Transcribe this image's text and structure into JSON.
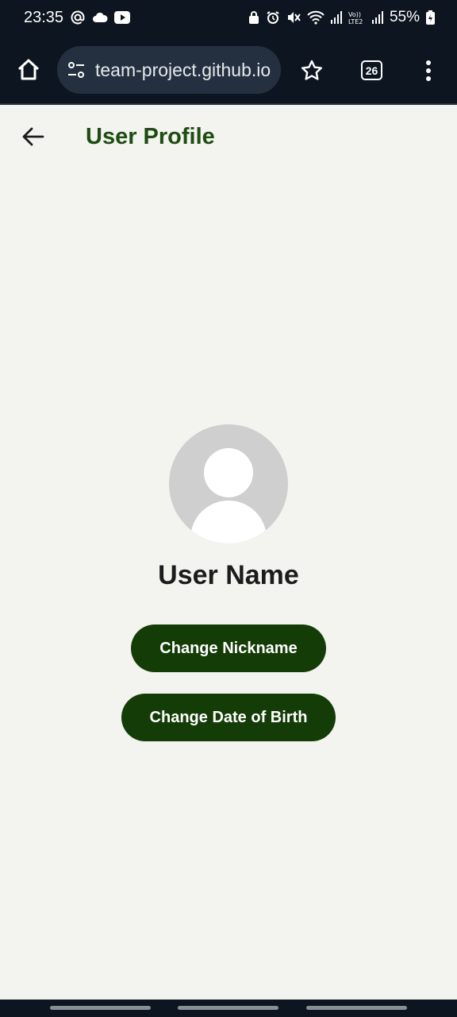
{
  "status_bar": {
    "time": "23:35",
    "battery_text": "55%",
    "icons_left": [
      "at-sign-icon",
      "cloud-icon",
      "youtube-icon"
    ],
    "icons_right": [
      "lock-icon",
      "alarm-icon",
      "mute-icon",
      "wifi-icon",
      "signal-icon",
      "volte-icon",
      "signal-icon",
      "battery-icon"
    ]
  },
  "browser": {
    "url": "team-project.github.io",
    "tab_count": "26"
  },
  "header": {
    "title": "User Profile"
  },
  "profile": {
    "user_name": "User Name",
    "change_nickname_label": "Change Nickname",
    "change_dob_label": "Change Date of Birth"
  },
  "colors": {
    "accent": "#143c06",
    "title_color": "#1e4d12",
    "background": "#f3f3ef",
    "status_bar": "#0d1620"
  }
}
